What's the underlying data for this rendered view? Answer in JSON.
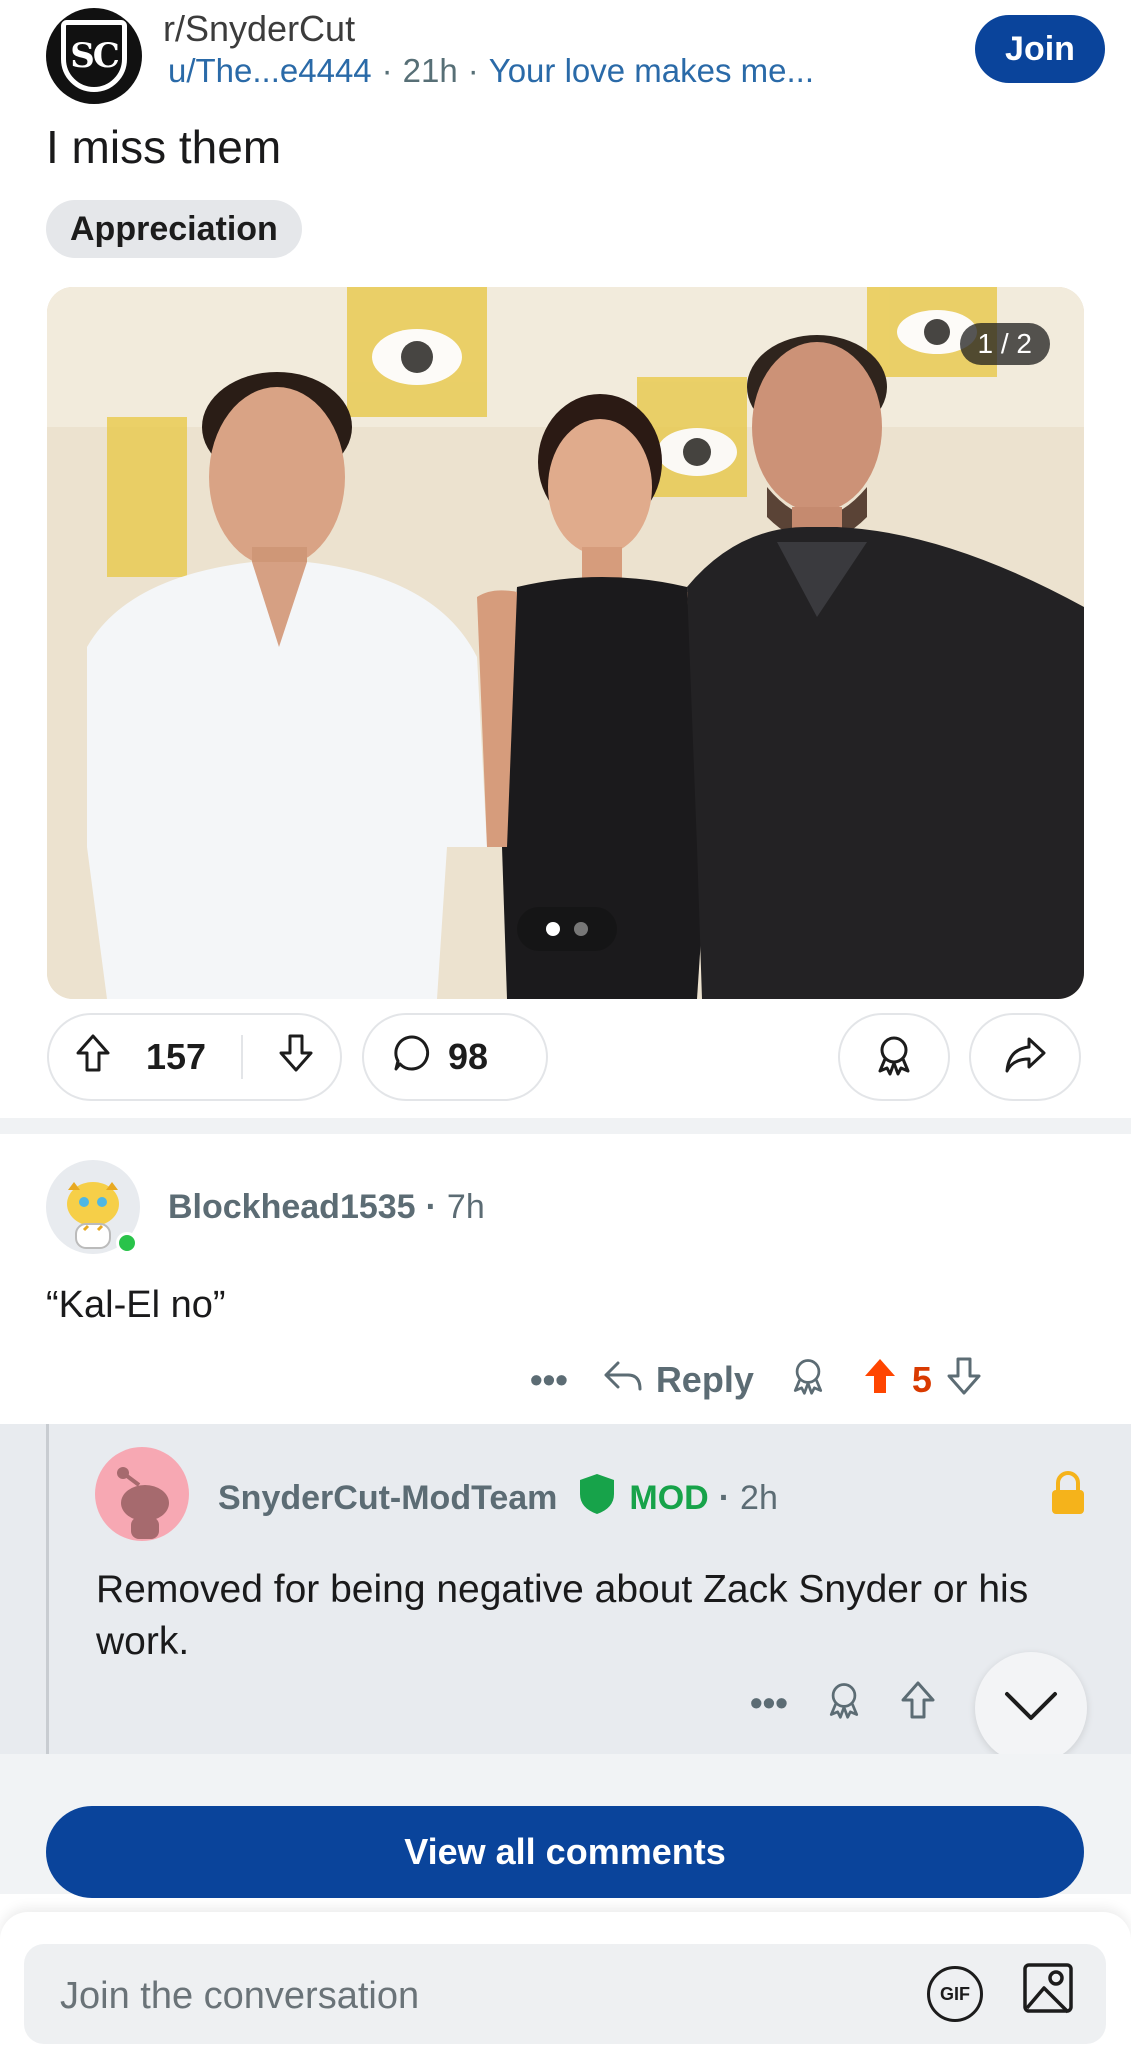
{
  "header": {
    "subreddit": "r/SnyderCut",
    "subreddit_logo_text": "SC",
    "author": "u/The...e4444",
    "dot": "·",
    "time": "21h",
    "extra": "Your love makes me...",
    "join_label": "Join"
  },
  "post": {
    "title": "I miss them",
    "flair": "Appreciation",
    "image_counter": "1 / 2",
    "carousel": {
      "total": 2,
      "active": 1
    },
    "upvotes": "157",
    "comments": "98"
  },
  "comment": {
    "author": "Blockhead1535",
    "dot": "·",
    "time": "7h",
    "body": "“Kal-El no”",
    "more": "•••",
    "reply_label": "Reply",
    "votes": "5"
  },
  "mod_reply": {
    "author": "SnyderCut-ModTeam",
    "badge": "MOD",
    "dot": "·",
    "time": "2h",
    "body": "Removed for being negative about Zack Snyder or his work.",
    "more": "•••"
  },
  "footer": {
    "view_all_label": "View all comments",
    "composer_placeholder": "Join the conversation",
    "gif_label": "GIF"
  },
  "colors": {
    "join": "#0a449b",
    "upvote_active": "#ff4500",
    "mod": "#17a34a",
    "lock": "#f5b31b"
  }
}
